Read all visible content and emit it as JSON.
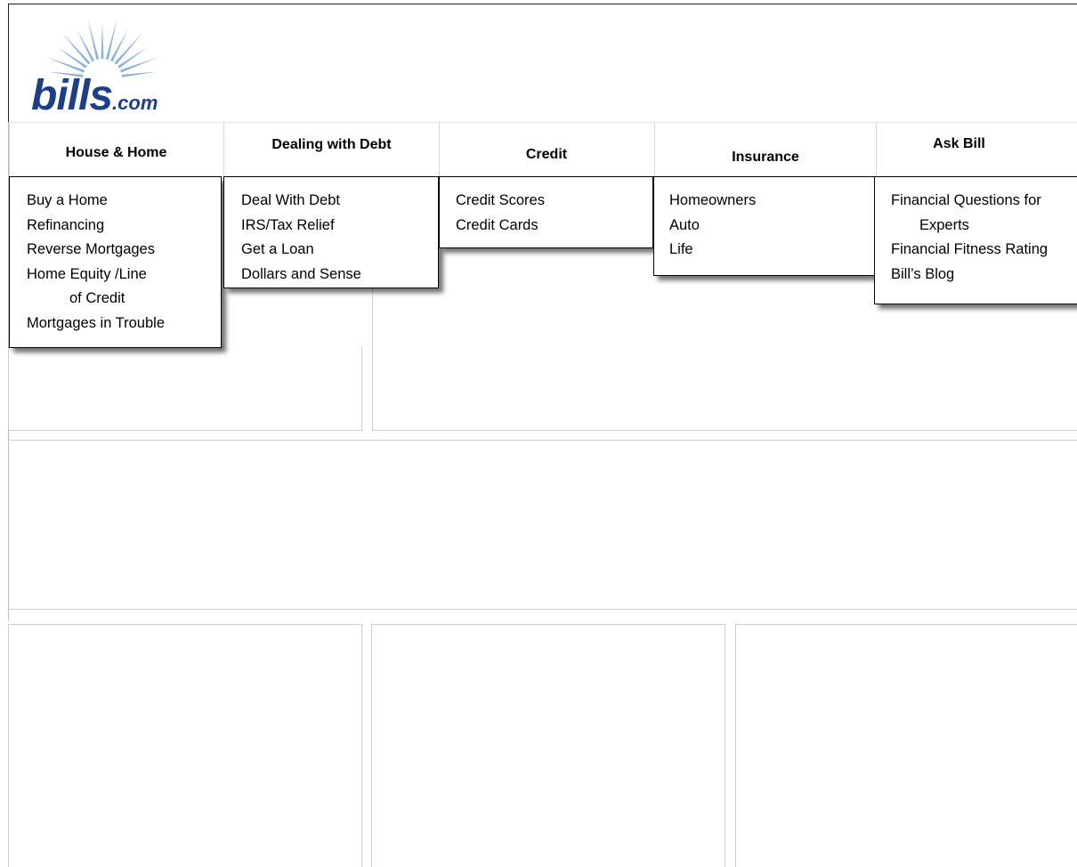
{
  "logo": {
    "brand": "bills",
    "suffix": ".com",
    "brand_color": "#1d3f88",
    "ray_color": "#8fb3dc"
  },
  "nav": {
    "tabs": [
      {
        "label": "House & Home",
        "items": [
          "Buy a Home",
          "Refinancing",
          "Reverse Mortgages",
          "Home Equity /Line",
          "of Credit",
          "Mortgages in Trouble"
        ]
      },
      {
        "label": "Dealing with Debt",
        "items": [
          "Deal With Debt",
          "IRS/Tax Relief",
          "Get a Loan",
          "Dollars and Sense"
        ]
      },
      {
        "label": "Credit",
        "items": [
          "Credit Scores",
          "Credit Cards"
        ]
      },
      {
        "label": "Insurance",
        "items": [
          "Homeowners",
          "Auto",
          "Life"
        ]
      },
      {
        "label": "Ask Bill",
        "items": [
          "Financial Questions for",
          "Experts",
          "Financial Fitness Rating",
          "Bill’s Blog"
        ]
      }
    ]
  }
}
